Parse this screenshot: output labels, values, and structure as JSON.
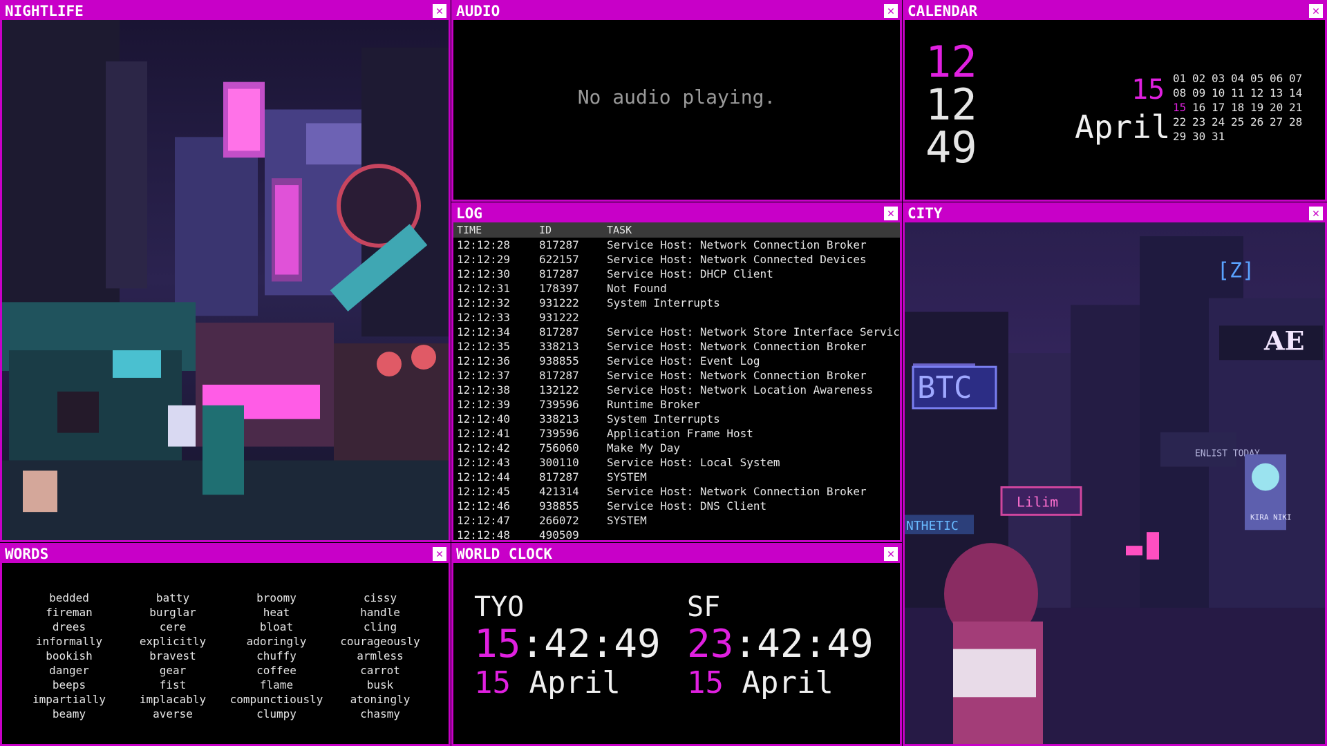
{
  "windows": {
    "nightlife": {
      "title": "NIGHTLIFE"
    },
    "audio": {
      "title": "AUDIO",
      "message": "No audio playing."
    },
    "calendar": {
      "title": "CALENDAR",
      "hour": "12",
      "minute": "12",
      "second": "49",
      "day": "15",
      "month": "April",
      "dates": [
        [
          "01",
          "02",
          "03",
          "04",
          "05",
          "06",
          "07"
        ],
        [
          "08",
          "09",
          "10",
          "11",
          "12",
          "13",
          "14"
        ],
        [
          "15",
          "16",
          "17",
          "18",
          "19",
          "20",
          "21"
        ],
        [
          "22",
          "23",
          "24",
          "25",
          "26",
          "27",
          "28"
        ],
        [
          "29",
          "30",
          "31"
        ]
      ],
      "today": "15"
    },
    "log": {
      "title": "LOG",
      "columns": [
        "TIME",
        "ID",
        "TASK"
      ],
      "rows": [
        [
          "12:12:28",
          "817287",
          "Service Host: Network Connection Broker"
        ],
        [
          "12:12:29",
          "622157",
          "Service Host: Network Connected Devices"
        ],
        [
          "12:12:30",
          "817287",
          "Service Host: DHCP Client"
        ],
        [
          "12:12:31",
          "178397",
          "Not Found"
        ],
        [
          "12:12:32",
          "931222",
          "System Interrupts"
        ],
        [
          "12:12:33",
          "931222",
          ""
        ],
        [
          "12:12:34",
          "817287",
          "Service Host: Network Store Interface Service"
        ],
        [
          "12:12:35",
          "338213",
          "Service Host: Network Connection Broker"
        ],
        [
          "12:12:36",
          "938855",
          "Service Host: Event Log"
        ],
        [
          "12:12:37",
          "817287",
          "Service Host: Network Connection Broker"
        ],
        [
          "12:12:38",
          "132122",
          "Service Host: Network Location Awareness"
        ],
        [
          "12:12:39",
          "739596",
          "Runtime Broker"
        ],
        [
          "12:12:40",
          "338213",
          "System Interrupts"
        ],
        [
          "12:12:41",
          "739596",
          "Application Frame Host"
        ],
        [
          "12:12:42",
          "756060",
          "Make My Day"
        ],
        [
          "12:12:43",
          "300110",
          "Service Host: Local System"
        ],
        [
          "12:12:44",
          "817287",
          "SYSTEM"
        ],
        [
          "12:12:45",
          "421314",
          "Service Host: Network Connection Broker"
        ],
        [
          "12:12:46",
          "938855",
          "Service Host: DNS Client"
        ],
        [
          "12:12:47",
          "266072",
          "SYSTEM"
        ],
        [
          "12:12:48",
          "490509",
          ""
        ]
      ]
    },
    "city": {
      "title": "CITY",
      "signs": [
        "[Z]",
        "AE",
        "BTC",
        "ENLIST TODAY",
        "Lilim",
        "NTHETIC",
        "KIRA NIKI"
      ]
    },
    "words": {
      "title": "WORDS",
      "columns": [
        [
          "bedded",
          "fireman",
          "drees",
          "informally",
          "bookish",
          "danger",
          "beeps",
          "impartially",
          "beamy"
        ],
        [
          "batty",
          "burglar",
          "cere",
          "explicitly",
          "bravest",
          "gear",
          "fist",
          "implacably",
          "averse"
        ],
        [
          "broomy",
          "heat",
          "bloat",
          "adoringly",
          "chuffy",
          "coffee",
          "flame",
          "compunctiously",
          "clumpy"
        ],
        [
          "cissy",
          "handle",
          "cling",
          "courageously",
          "armless",
          "carrot",
          "busk",
          "atoningly",
          "chasmy"
        ]
      ]
    },
    "clock": {
      "title": "WORLD CLOCK",
      "zones": [
        {
          "city": "TYO",
          "hour": "15",
          "rest": ":42:49",
          "day": "15",
          "month": " April"
        },
        {
          "city": "SF",
          "hour": "23",
          "rest": ":42:49",
          "day": "15",
          "month": " April"
        }
      ]
    }
  },
  "colors": {
    "accent": "#c800c8",
    "highlight": "#e020e0",
    "background": "#000000"
  },
  "icons": {
    "close": "close-icon"
  }
}
